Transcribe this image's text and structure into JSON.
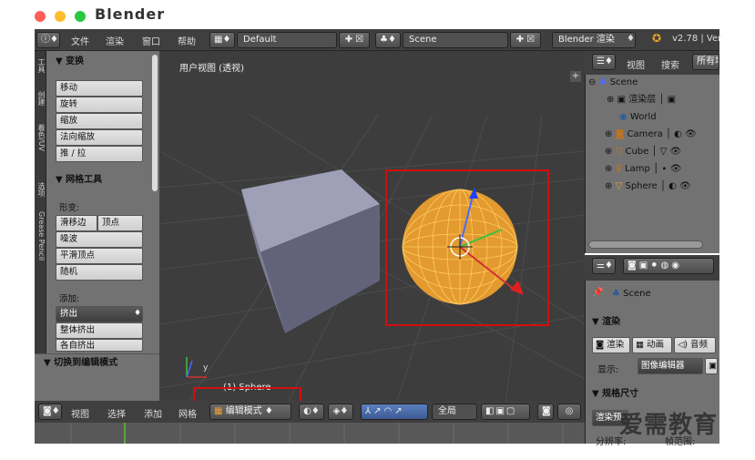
{
  "window": {
    "title": "Blender"
  },
  "info_header": {
    "menus": [
      "文件",
      "渲染",
      "窗口",
      "帮助"
    ],
    "screen_layout": "Default",
    "scene": "Scene",
    "render_engine": "Blender 渲染",
    "version": "v2.78 | Ver"
  },
  "tool_tabs": [
    "工具",
    "创建",
    "着色/UV",
    "选项",
    "Grease Pencil"
  ],
  "tool_shelf": {
    "transform_header": "▼ 变换",
    "transform_buttons": [
      "移动",
      "旋转",
      "缩放",
      "法向缩放",
      "推 / 拉"
    ],
    "mesh_tools_header": "▼ 网格工具",
    "deform_label": "形变:",
    "deform_buttons": [
      "滑移边",
      "顶点",
      "噪波",
      "平滑顶点",
      "随机"
    ],
    "add_label": "添加:",
    "add_buttons": [
      "挤出",
      "整体挤出",
      "各自挤出"
    ],
    "operator_panel": "▼ 切换到编辑模式"
  },
  "viewport": {
    "title": "用户视图 (透视)",
    "object_label": "(1) Sphere",
    "axis_y": "y"
  },
  "outliner": {
    "view_menu": "视图",
    "search_menu": "搜索",
    "filter": "所有场",
    "items": [
      {
        "label": "Scene",
        "depth": 0
      },
      {
        "label": "渲染层",
        "depth": 1
      },
      {
        "label": "World",
        "depth": 1
      },
      {
        "label": "Camera",
        "depth": 1
      },
      {
        "label": "Cube",
        "depth": 1
      },
      {
        "label": "Lamp",
        "depth": 1
      },
      {
        "label": "Sphere",
        "depth": 1
      }
    ]
  },
  "properties": {
    "scene_path": "Scene",
    "render_panel": "▼ 渲染",
    "render_buttons": [
      "渲染",
      "动画",
      "音频"
    ],
    "display_label": "显示:",
    "display_value": "图像编辑器",
    "dimensions_panel": "▼ 规格尺寸",
    "preset_button": "渲染预",
    "resolution_label": "分辨率:",
    "frame_label": "帧范围:"
  },
  "view3d_header": {
    "menus": [
      "视图",
      "选择",
      "添加",
      "网格"
    ],
    "mode": "编辑模式",
    "pivot": "全局"
  },
  "watermark": "爱需教育",
  "colors": {
    "highlight_box": "#d20e0e",
    "selection_orange": "#f0a030",
    "viewport_bg": "#3d3d3d",
    "panel_bg": "#727272"
  }
}
